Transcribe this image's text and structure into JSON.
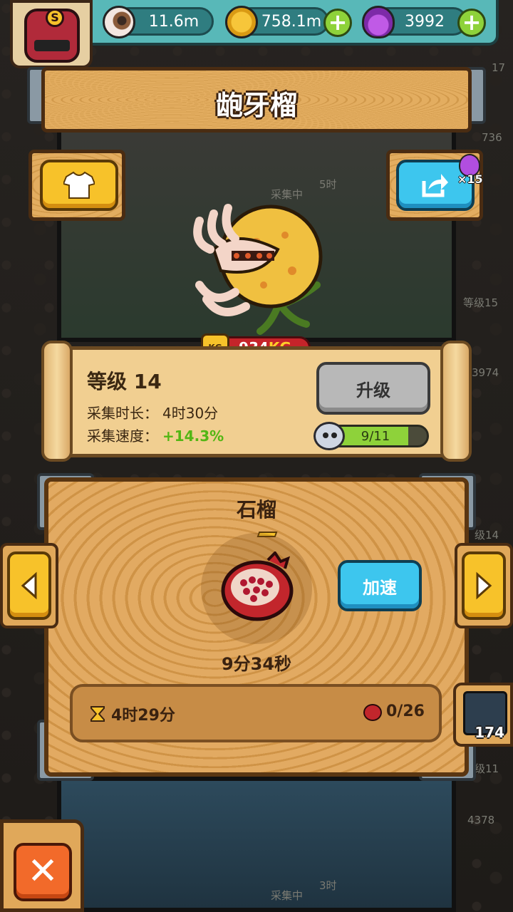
{
  "resources": {
    "eyeball": {
      "icon": "eyeball-icon",
      "value": "11.6m"
    },
    "coin": {
      "icon": "coin-icon",
      "value": "758.1m"
    },
    "potion": {
      "icon": "potion-icon",
      "value": "3992"
    }
  },
  "title": "龅牙榴",
  "share_badge": "×15",
  "weight": {
    "number": "934",
    "unit": "KG",
    "icon_text": "KG"
  },
  "stats": {
    "level_label": "等级 14",
    "duration_label": "采集时长：",
    "duration_value": "4时30分",
    "speed_label": "采集速度：",
    "speed_value": "+14.3%"
  },
  "upgrade_button": "升级",
  "upgrade_progress": {
    "text": "9/11",
    "current": 9,
    "max": 11
  },
  "product": {
    "name": "石榴",
    "timer": "9分34秒",
    "speedup_button": "加速",
    "remaining_time": "4时29分",
    "count": "0/26"
  },
  "side_card_count": "174",
  "background_labels": {
    "collecting_top": "采集中",
    "hours_top": "5时",
    "collecting_bottom": "采集中",
    "hours_bottom": "3时",
    "side_1": "736",
    "side_2": "等级15",
    "side_3": "3974",
    "side_4": "级14",
    "side_5": "级11",
    "side_6": "4378",
    "side_7": "17"
  }
}
